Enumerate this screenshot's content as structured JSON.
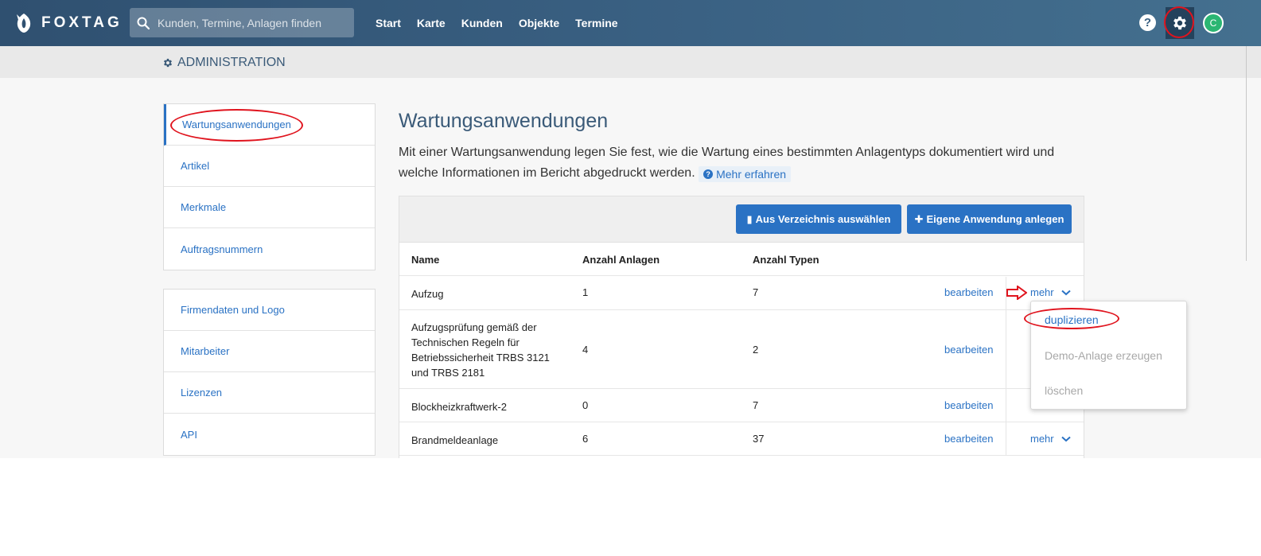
{
  "navbar": {
    "logo_text": "FOXTAG",
    "search_placeholder": "Kunden, Termine, Anlagen finden",
    "links": [
      "Start",
      "Karte",
      "Kunden",
      "Objekte",
      "Termine"
    ],
    "help": "?",
    "avatar_initial": "C"
  },
  "admin_bar": {
    "title": "ADMINISTRATION"
  },
  "sidebar": {
    "group1": [
      "Wartungsanwendungen",
      "Artikel",
      "Merkmale",
      "Auftragsnummern"
    ],
    "group2": [
      "Firmendaten und Logo",
      "Mitarbeiter",
      "Lizenzen",
      "API"
    ],
    "active": "Wartungsanwendungen"
  },
  "main": {
    "title": "Wartungsanwendungen",
    "description": "Mit einer Wartungsanwendung legen Sie fest, wie die Wartung eines bestimmten Anlagentyps dokumentiert wird und welche Informationen im Bericht abgedruckt werden.",
    "learn_more": "Mehr erfahren",
    "buttons": {
      "from_directory": "Aus Verzeichnis auswählen",
      "create_own": "Eigene Anwendung anlegen"
    },
    "table": {
      "columns": [
        "Name",
        "Anzahl Anlagen",
        "Anzahl Typen"
      ],
      "rows": [
        {
          "name": "Aufzug",
          "anlagen": "1",
          "typen": "7",
          "edit": "bearbeiten",
          "more": "mehr"
        },
        {
          "name": "Aufzugsprüfung gemäß der Technischen Regeln für Betriebssicherheit TRBS 3121 und TRBS 2181",
          "anlagen": "4",
          "typen": "2",
          "edit": "bearbeiten",
          "more": ""
        },
        {
          "name": "Blockheizkraftwerk-2",
          "anlagen": "0",
          "typen": "7",
          "edit": "bearbeiten",
          "more": ""
        },
        {
          "name": "Brandmeldeanlage",
          "anlagen": "6",
          "typen": "37",
          "edit": "bearbeiten",
          "more": "mehr"
        }
      ]
    },
    "dropdown": {
      "items": [
        "duplizieren",
        "Demo-Anlage erzeugen",
        "löschen"
      ]
    }
  },
  "colors": {
    "navbar": "#3a6183",
    "link": "#2a72c4",
    "annotation": "#e0141e"
  }
}
